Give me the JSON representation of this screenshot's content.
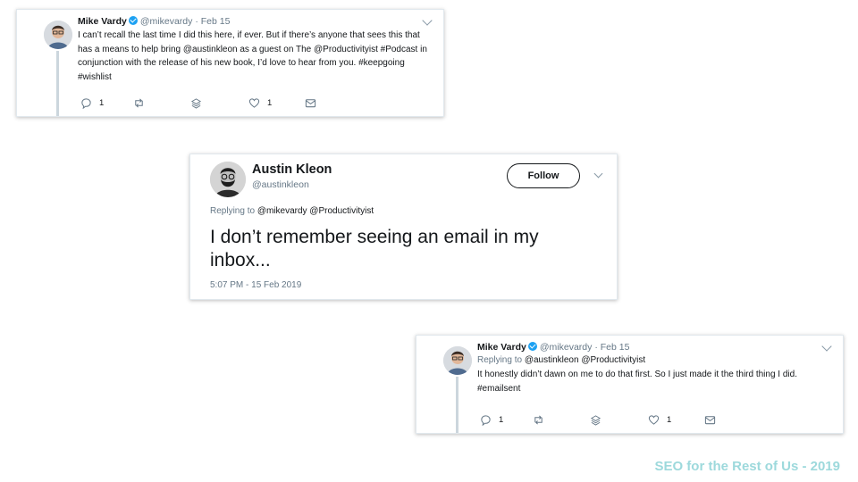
{
  "tweet1": {
    "name": "Mike Vardy",
    "handle": "@mikevardy",
    "sep": "·",
    "date": "Feb 15",
    "text": "I can’t recall the last time I did this here, if ever. But if there’s anyone that sees this that has a means to help bring @austinkleon as a guest on The @Productivityist #Podcast in conjunction with the release of his new book, I’d love to hear from you. #keepgoing #wishlist",
    "replies": "1",
    "likes": "1"
  },
  "tweet2": {
    "name": "Austin Kleon",
    "handle": "@austinkleon",
    "follow_label": "Follow",
    "replying_label": "Replying to",
    "replying_to": "@mikevardy @Productivityist",
    "text": "I don’t remember seeing an email in my inbox...",
    "timestamp": "5:07 PM - 15 Feb 2019"
  },
  "tweet3": {
    "name": "Mike Vardy",
    "handle": "@mikevardy",
    "sep": "·",
    "date": "Feb 15",
    "replying_label": "Replying to",
    "replying_to": "@austinkleon @Productivityist",
    "text": "It honestly didn’t dawn on me to do that first. So I just made it the third thing I did. #emailsent",
    "replies": "1",
    "likes": "1"
  },
  "footer": "SEO for the Rest of Us - 2019",
  "colors": {
    "twitter_blue": "#1da1f2",
    "muted": "#657786",
    "footer": "#9dd9dc"
  }
}
